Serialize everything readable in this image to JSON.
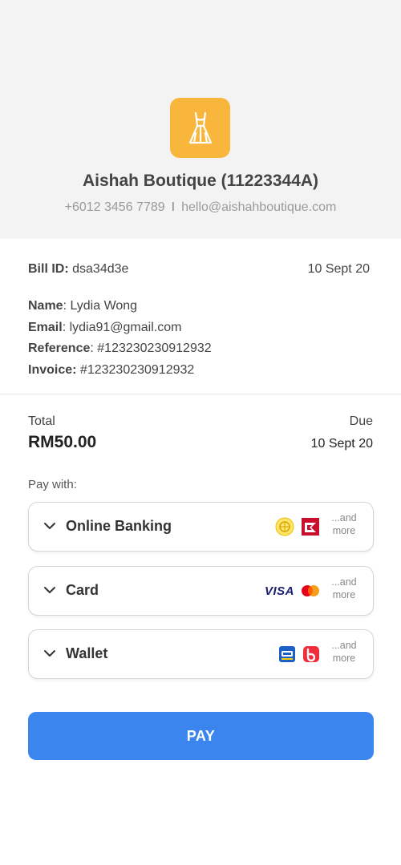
{
  "merchant": {
    "name": "Aishah Boutique (11223344A)",
    "phone": "+6012 3456 7789",
    "separator": "I",
    "email": "hello@aishahboutique.com",
    "logo_icon": "dress-icon",
    "logo_color": "#f9b63c"
  },
  "bill": {
    "id_label": "Bill ID:",
    "id_value": "dsa34d3e",
    "date": "10 Sept 20",
    "name_label": "Name",
    "name_value": ": Lydia Wong",
    "email_label": "Email",
    "email_value": ": lydia91@gmail.com",
    "reference_label": "Reference",
    "reference_value": ": #123230230912932",
    "invoice_label": "Invoice:",
    "invoice_value": "#123230230912932"
  },
  "summary": {
    "total_label": "Total",
    "total_value": "RM50.00",
    "due_label": "Due",
    "due_value": "10 Sept 20"
  },
  "payment": {
    "pay_with_label": "Pay with:",
    "methods": [
      {
        "label": "Online Banking",
        "logos": [
          "maybank-logo-icon",
          "cimb-logo-icon"
        ],
        "more": "...and more"
      },
      {
        "label": "Card",
        "logos": [
          "visa-logo-icon",
          "mastercard-logo-icon"
        ],
        "visa_text": "VISA",
        "more": "...and more"
      },
      {
        "label": "Wallet",
        "logos": [
          "touch-n-go-logo-icon",
          "boost-logo-icon"
        ],
        "more": "...and more"
      }
    ],
    "pay_button": "PAY",
    "accent": "#3b86ee"
  }
}
